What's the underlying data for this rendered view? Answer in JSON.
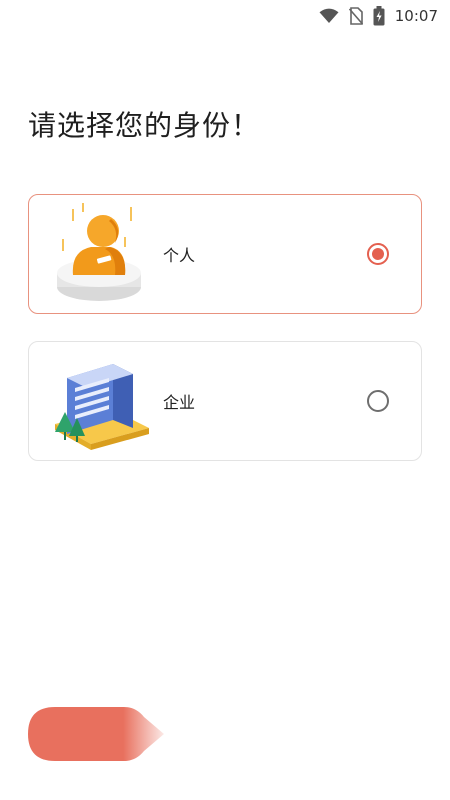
{
  "status_bar": {
    "time": "10:07"
  },
  "page": {
    "title": "请选择您的身份！"
  },
  "roles": [
    {
      "label": "个人",
      "selected": true
    },
    {
      "label": "企业",
      "selected": false
    }
  ],
  "colors": {
    "accent": "#e4604f",
    "selected_border": "#e8927f",
    "card_border": "#e3e3e3",
    "button": "#e8705e"
  },
  "icons": [
    "wifi-icon",
    "no-sim-icon",
    "battery-charging-icon",
    "person-illustration",
    "building-illustration",
    "radio-checked-icon",
    "radio-unchecked-icon"
  ]
}
